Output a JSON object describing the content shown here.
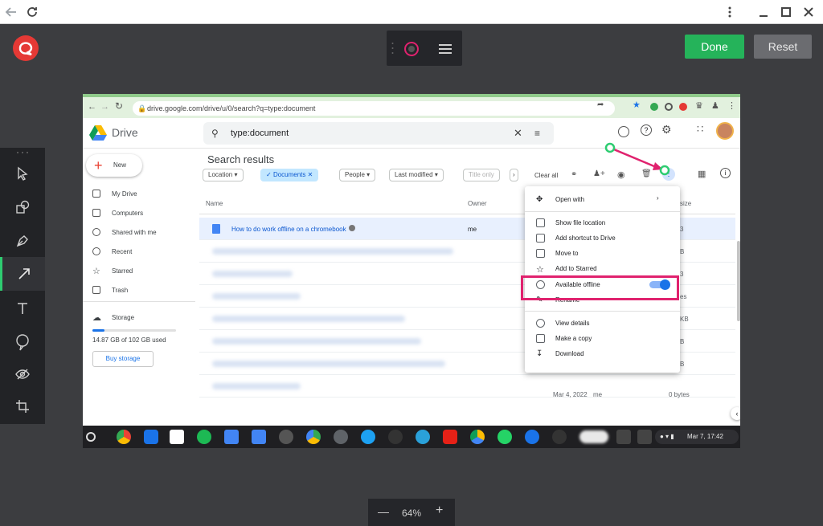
{
  "editor": {
    "done_label": "Done",
    "reset_label": "Reset",
    "zoom_value": "64%",
    "zoom_minus": "—",
    "zoom_plus": "+"
  },
  "browser": {
    "url": "drive.google.com/drive/u/0/search?q=type:document"
  },
  "drive": {
    "logo_text": "Drive",
    "search_value": "type:document",
    "new_label": "New",
    "nav": [
      "My Drive",
      "Computers",
      "Shared with me",
      "Recent",
      "Starred",
      "Trash"
    ],
    "storage_label": "Storage",
    "storage_used": "14.87 GB of 102 GB used",
    "storage_fraction": 0.146,
    "buy_storage": "Buy storage",
    "results_title": "Search results",
    "filters": [
      "Location",
      "Documents",
      "People",
      "Last modified",
      "Title only"
    ],
    "clear_all": "Clear all",
    "col_name": "Name",
    "col_owner": "Owner",
    "col_size": "size",
    "first_file": "How to do work offline on a chromebook",
    "first_owner": "me",
    "last_modified": "Mar 4, 2022",
    "last_owner": "me",
    "last_size": "0 bytes",
    "partial_sizes": [
      "3",
      "B",
      "3",
      "es",
      "KB",
      "B",
      "B"
    ]
  },
  "context_menu": {
    "items": [
      "Open with",
      "Show file location",
      "Add shortcut to Drive",
      "Move to",
      "Add to Starred",
      "Available offline",
      "Rename",
      "View details",
      "Make a copy",
      "Download"
    ]
  },
  "shelf": {
    "date_time": "Mar 7, 17:42"
  },
  "colors": {
    "accent_green": "#2ecc71",
    "highlight": "#e0226e",
    "drive_blue": "#1a73e8"
  }
}
